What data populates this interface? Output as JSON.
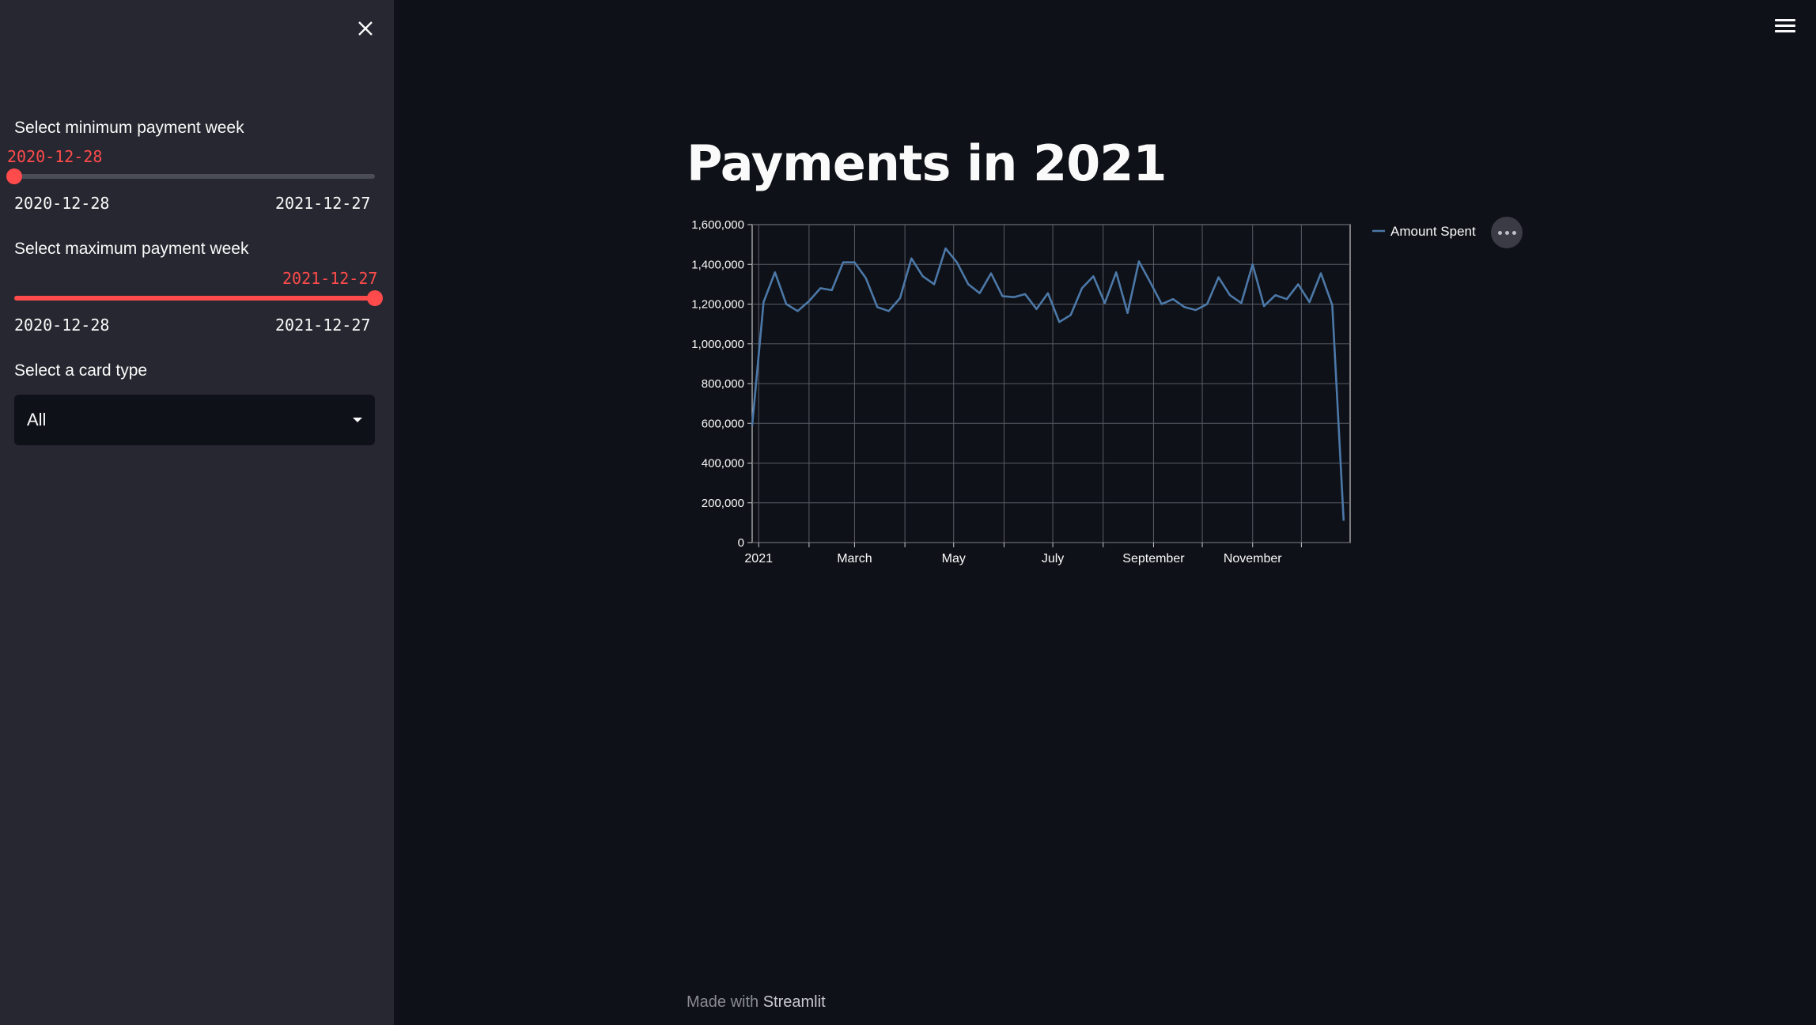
{
  "sidebar": {
    "close_icon": "close-icon",
    "min_week": {
      "label": "Select minimum payment week",
      "value": "2020-12-28",
      "range_min": "2020-12-28",
      "range_max": "2021-12-27",
      "fraction": 0.0
    },
    "max_week": {
      "label": "Select maximum payment week",
      "value": "2021-12-27",
      "range_min": "2020-12-28",
      "range_max": "2021-12-27",
      "fraction": 1.0
    },
    "card_type": {
      "label": "Select a card type",
      "value": "All"
    },
    "accent_color": "#ff4b4b"
  },
  "header": {
    "menu_icon": "hamburger-menu-icon"
  },
  "main": {
    "title": "Payments in 2021",
    "footer": {
      "prefix": "Made with ",
      "brand": "Streamlit"
    }
  },
  "chart_data": {
    "type": "line",
    "title": "",
    "xlabel": "",
    "ylabel": "",
    "ylim": [
      0,
      1600000
    ],
    "y_ticks": [
      0,
      200000,
      400000,
      600000,
      800000,
      1000000,
      1200000,
      1400000,
      1600000
    ],
    "y_tick_labels": [
      "0",
      "200,000",
      "400,000",
      "600,000",
      "800,000",
      "1,000,000",
      "1,200,000",
      "1,400,000",
      "1,600,000"
    ],
    "x_tick_labels": [
      {
        "label": "2021",
        "date": "2021-01-01"
      },
      {
        "label": "March",
        "date": "2021-03-01"
      },
      {
        "label": "May",
        "date": "2021-05-01"
      },
      {
        "label": "July",
        "date": "2021-07-01"
      },
      {
        "label": "September",
        "date": "2021-09-01"
      },
      {
        "label": "November",
        "date": "2021-11-01"
      }
    ],
    "x_gridlines": [
      "2021-01-01",
      "2021-02-01",
      "2021-03-01",
      "2021-04-01",
      "2021-05-01",
      "2021-06-01",
      "2021-07-01",
      "2021-08-01",
      "2021-09-01",
      "2021-10-01",
      "2021-11-01",
      "2021-12-01"
    ],
    "xlim": [
      "2020-12-28",
      "2021-12-31"
    ],
    "grid": true,
    "legend_position": "right",
    "line_color": "#4c78a8",
    "series": [
      {
        "name": "Amount Spent",
        "x": [
          "2020-12-28",
          "2021-01-04",
          "2021-01-11",
          "2021-01-18",
          "2021-01-25",
          "2021-02-01",
          "2021-02-08",
          "2021-02-15",
          "2021-02-22",
          "2021-03-01",
          "2021-03-08",
          "2021-03-15",
          "2021-03-22",
          "2021-03-29",
          "2021-04-05",
          "2021-04-12",
          "2021-04-19",
          "2021-04-26",
          "2021-05-03",
          "2021-05-10",
          "2021-05-17",
          "2021-05-24",
          "2021-05-31",
          "2021-06-07",
          "2021-06-14",
          "2021-06-21",
          "2021-06-28",
          "2021-07-05",
          "2021-07-12",
          "2021-07-19",
          "2021-07-26",
          "2021-08-02",
          "2021-08-09",
          "2021-08-16",
          "2021-08-23",
          "2021-08-30",
          "2021-09-06",
          "2021-09-13",
          "2021-09-20",
          "2021-09-27",
          "2021-10-04",
          "2021-10-11",
          "2021-10-18",
          "2021-10-25",
          "2021-11-01",
          "2021-11-08",
          "2021-11-15",
          "2021-11-22",
          "2021-11-29",
          "2021-12-06",
          "2021-12-13",
          "2021-12-20",
          "2021-12-27"
        ],
        "values": [
          590000,
          1210000,
          1360000,
          1200000,
          1165000,
          1215000,
          1280000,
          1270000,
          1410000,
          1410000,
          1330000,
          1185000,
          1165000,
          1230000,
          1430000,
          1340000,
          1300000,
          1480000,
          1410000,
          1300000,
          1255000,
          1355000,
          1240000,
          1235000,
          1250000,
          1175000,
          1255000,
          1110000,
          1145000,
          1280000,
          1340000,
          1205000,
          1360000,
          1155000,
          1415000,
          1310000,
          1200000,
          1225000,
          1185000,
          1170000,
          1200000,
          1335000,
          1245000,
          1205000,
          1400000,
          1190000,
          1245000,
          1225000,
          1300000,
          1210000,
          1355000,
          1195000,
          110000
        ]
      }
    ]
  }
}
